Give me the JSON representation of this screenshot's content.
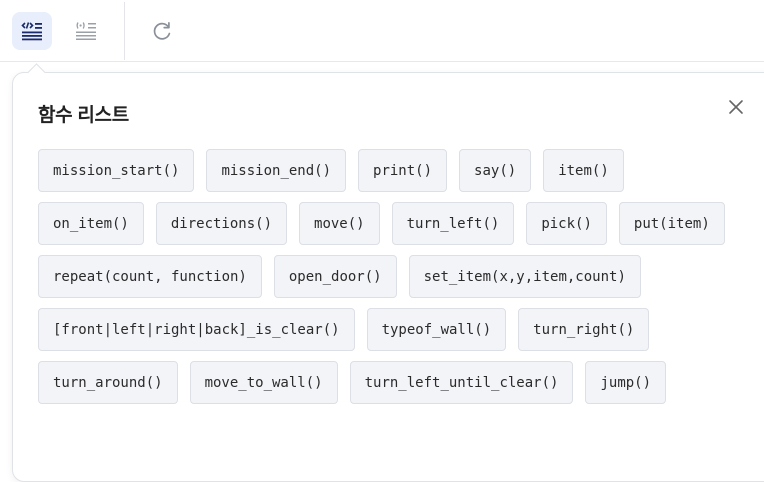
{
  "toolbar": {
    "buttons": [
      {
        "name": "code-view-button",
        "icon": "code-list-icon",
        "active": true
      },
      {
        "name": "text-view-button",
        "icon": "text-list-icon",
        "active": false
      },
      {
        "name": "refresh-button",
        "icon": "refresh-icon",
        "active": false
      }
    ]
  },
  "popover": {
    "title": "함수 리스트",
    "close_icon": "close-icon",
    "functions": [
      "mission_start()",
      "mission_end()",
      "print()",
      "say()",
      "item()",
      "on_item()",
      "directions()",
      "move()",
      "turn_left()",
      "pick()",
      "put(item)",
      "repeat(count, function)",
      "open_door()",
      "set_item(x,y,item,count)",
      "[front|left|right|back]_is_clear()",
      "typeof_wall()",
      "turn_right()",
      "turn_around()",
      "move_to_wall()",
      "turn_left_until_clear()",
      "jump()"
    ]
  },
  "colors": {
    "accent": "#1b2a6b",
    "active_bg": "#e8eefc",
    "chip_bg": "#f3f4f8",
    "chip_border": "#dcdfe6"
  }
}
